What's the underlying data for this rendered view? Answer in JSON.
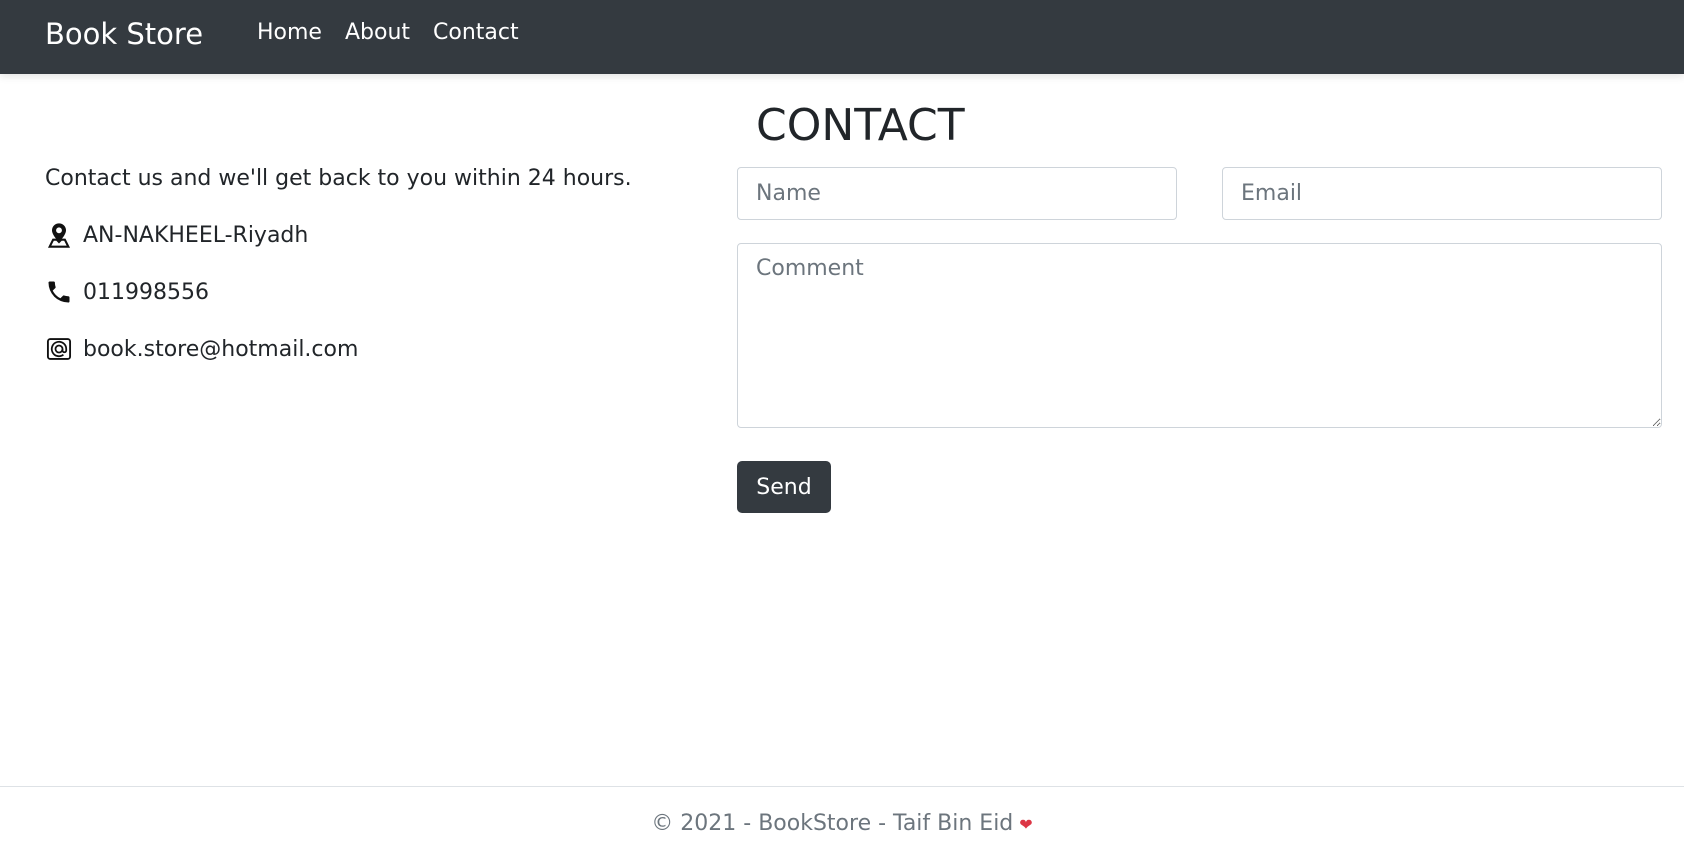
{
  "navbar": {
    "brand": "Book Store",
    "links": [
      "Home",
      "About",
      "Contact"
    ]
  },
  "page": {
    "title": "CONTACT",
    "lead": "Contact us and we'll get back to you within 24 hours.",
    "address": "AN-NAKHEEL-Riyadh",
    "phone": "011998556",
    "email": "book.store@hotmail.com"
  },
  "form": {
    "name_placeholder": "Name",
    "email_placeholder": "Email",
    "comment_placeholder": "Comment",
    "send_label": "Send"
  },
  "footer": {
    "text": "© 2021 - BookStore - Taif Bin Eid",
    "heart": "❤"
  },
  "colors": {
    "navbar_bg": "#343a40",
    "button_bg": "#343a40",
    "heart": "#dc3545"
  },
  "icons": [
    "map-marker-icon",
    "phone-icon",
    "at-sign-icon",
    "heart-icon"
  ]
}
